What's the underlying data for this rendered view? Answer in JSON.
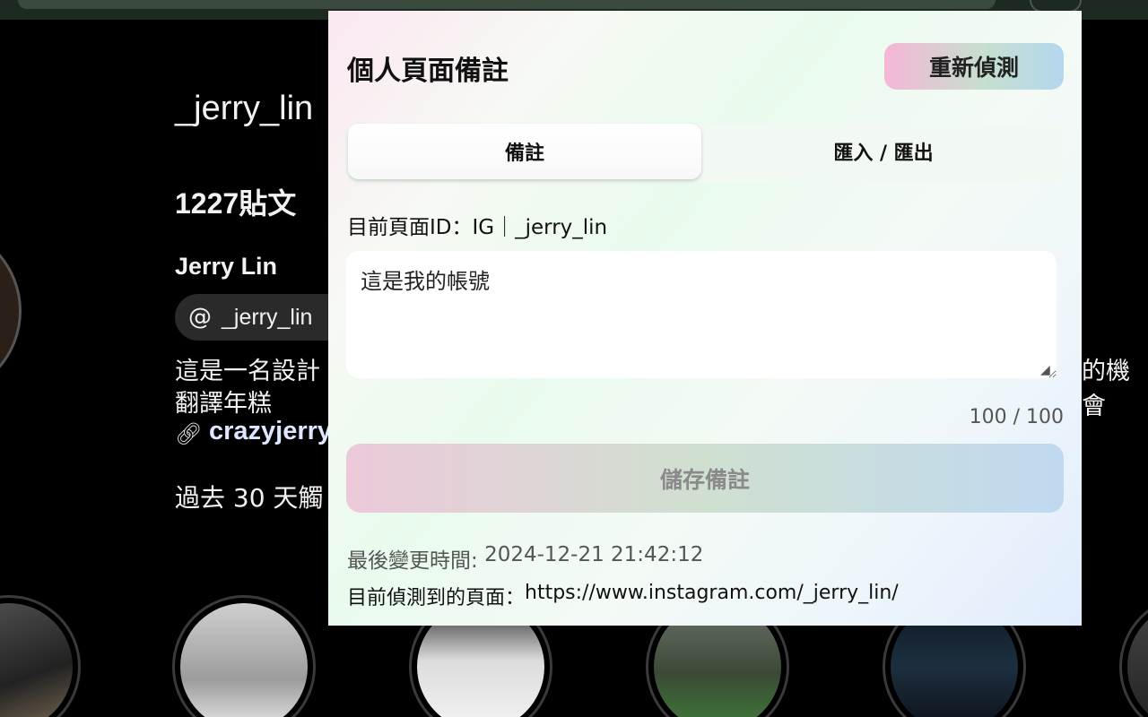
{
  "background": {
    "username": "_jerry_lin",
    "posts": "1227貼文",
    "full_name": "Jerry Lin",
    "threads_handle": "_jerry_lin",
    "bio_line1": "這是一名設計",
    "bio_line1_tail": "的機會",
    "bio_line2": "翻譯年糕",
    "link_text": "crazyjerry",
    "reach_text": "過去 30 天觸",
    "icons": {
      "threads": "threads-icon",
      "link": "link-icon"
    }
  },
  "popup": {
    "title": "個人頁面備註",
    "redetect_label": "重新偵測",
    "tabs": [
      {
        "label": "備註",
        "active": true
      },
      {
        "label": "匯入 / 匯出",
        "active": false
      }
    ],
    "page_id_label": "目前頁面ID：",
    "page_id_value": "IG｜_jerry_lin",
    "note_value": "這是我的帳號",
    "counter_current": "100",
    "counter_separator": " / ",
    "counter_max": "100",
    "save_label": "儲存備註",
    "last_changed_label": "最後變更時間: ",
    "last_changed_value": "2024-12-21 21:42:12",
    "detected_label": "目前偵測到的頁面：",
    "detected_url": "https://www.instagram.com/_jerry_lin/"
  },
  "colors": {
    "redetect_gradient": [
      "#f5b6d6",
      "#c6dfcf",
      "#b4d7ee"
    ],
    "save_gradient": [
      "#ecc9da",
      "#cfe0d0",
      "#c0d9f0"
    ]
  }
}
